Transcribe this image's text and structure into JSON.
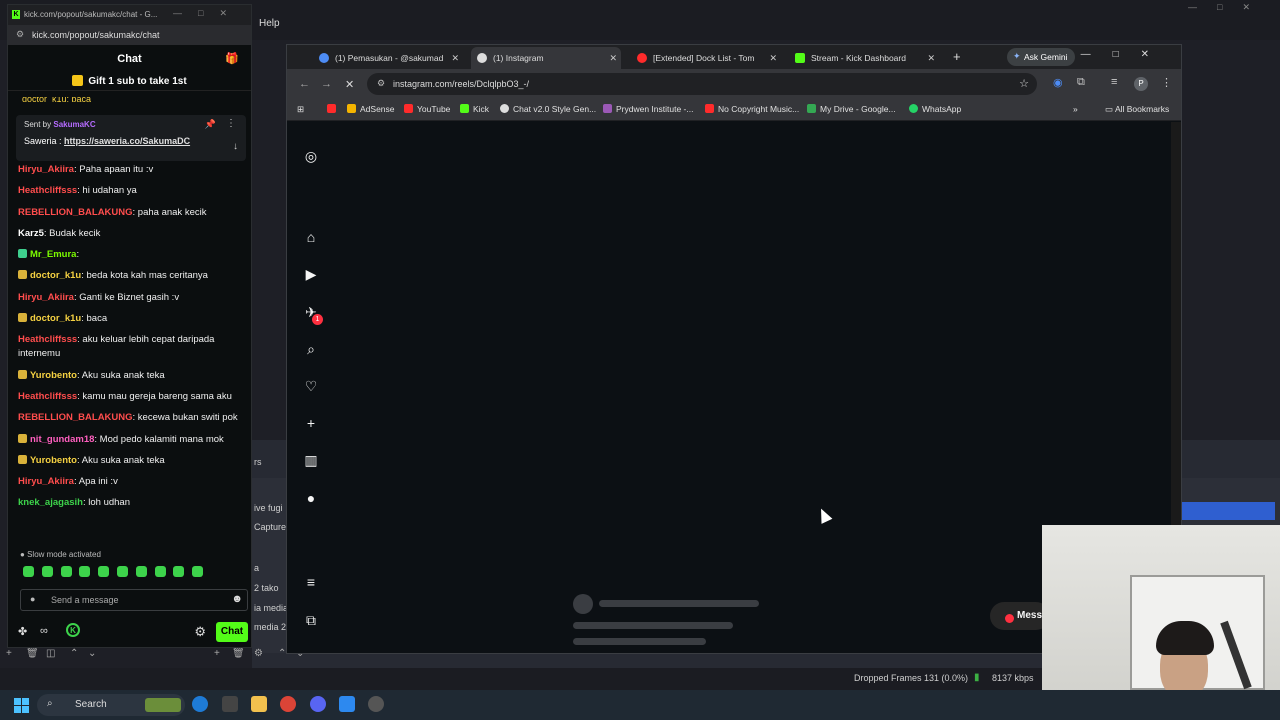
{
  "obs": {
    "menu_help": "Help",
    "dock_items": [
      "rs",
      "ive fugi",
      "Capture",
      "a",
      "2 tako",
      "ia media",
      "media 2"
    ],
    "dropped_frames": "Dropped Frames 131 (0.0%)",
    "bitrate": "8137 kbps",
    "toolbar_icons": [
      "plus-icon",
      "trash-icon",
      "filter-icon",
      "up-icon",
      "down-icon",
      "plus-icon",
      "trash-icon",
      "gear-icon",
      "up-icon",
      "down-icon"
    ]
  },
  "kick": {
    "window_title": "kick.com/popout/sakumakc/chat - G...",
    "url": "kick.com/popout/sakumakc/chat",
    "header": "Chat",
    "gift_text": "Gift 1 sub to take 1st",
    "pinned": {
      "sent_by_label": "Sent by",
      "sender": "SakumaKC",
      "text_prefix": "Saweria : ",
      "link": "https://saweria.co/SakumaDC"
    },
    "partial_top": "doctor_k1u: baca",
    "messages": [
      {
        "user": "Hiryu_Akiira",
        "color": "#ff4d4d",
        "badge": "",
        "text": ": Paha apaan itu :v"
      },
      {
        "user": "Heathcliffsss",
        "color": "#ff4d4d",
        "badge": "",
        "text": ": hi udahan ya"
      },
      {
        "user": "REBELLION_BALAKUNG",
        "color": "#ff4d4d",
        "badge": "",
        "text": ": paha anak kecik"
      },
      {
        "user": "Karz5",
        "color": "#ffffff",
        "badge": "",
        "text": ": Budak kecik"
      },
      {
        "user": "Mr_Emura",
        "color": "#7cfc00",
        "badge": "ic",
        "text": ":"
      },
      {
        "user": "doctor_k1u",
        "color": "#f5d142",
        "badge": "sub",
        "text": ": beda kota kah mas ceritanya"
      },
      {
        "user": "Hiryu_Akiira",
        "color": "#ff4d4d",
        "badge": "",
        "text": ": Ganti ke Biznet gasih :v"
      },
      {
        "user": "doctor_k1u",
        "color": "#f5d142",
        "badge": "sub",
        "text": ": baca"
      },
      {
        "user": "Heathcliffsss",
        "color": "#ff4d4d",
        "badge": "",
        "text": ": aku keluar lebih cepat daripada internemu"
      },
      {
        "user": "Yurobento",
        "color": "#f5d142",
        "badge": "sub",
        "text": ": Aku suka anak teka"
      },
      {
        "user": "Heathcliffsss",
        "color": "#ff4d4d",
        "badge": "",
        "text": ": kamu mau gereja bareng sama aku"
      },
      {
        "user": "REBELLION_BALAKUNG",
        "color": "#ff4d4d",
        "badge": "",
        "text": ": kecewa bukan switi pok"
      },
      {
        "user": "nit_gundam18",
        "color": "#ff5fbf",
        "badge": "sub",
        "text": ": Mod pedo kalamiti mana mok"
      },
      {
        "user": "Yurobento",
        "color": "#f5d142",
        "badge": "sub",
        "text": ": Aku suka anak teka"
      },
      {
        "user": "Hiryu_Akiira",
        "color": "#ff4d4d",
        "badge": "",
        "text": ": Apa ini :v"
      },
      {
        "user": "knek_ajagasih",
        "color": "#3dd34b",
        "badge": "",
        "text": ": loh udhan"
      }
    ],
    "slow_mode": "Slow mode activated",
    "input_placeholder": "Send a message",
    "chat_button": "Chat"
  },
  "chrome": {
    "tabs": [
      {
        "label": "(1) Pemasukan - @sakumad",
        "active": false,
        "icon_color": "#4d8cf5"
      },
      {
        "label": "(1) Instagram",
        "active": true,
        "icon_color": "#dddddd"
      },
      {
        "label": "[Extended] Dock List - Tom",
        "active": false,
        "icon_color": "#ff2b2b"
      },
      {
        "label": "Stream - Kick Dashboard",
        "active": false,
        "icon_color": "#53fc18"
      }
    ],
    "ask_gemini": "Ask Gemini",
    "url": "instagram.com/reels/DclqlpbO3_-/",
    "profile_initial": "P",
    "bookmarks": [
      {
        "label": "",
        "color": "#ff2b2b"
      },
      {
        "label": "AdSense",
        "color": "#f4b400"
      },
      {
        "label": "YouTube",
        "color": "#ff2b2b"
      },
      {
        "label": "Kick",
        "color": "#53fc18"
      },
      {
        "label": "Chat v2.0 Style Gen...",
        "color": "#dddddd"
      },
      {
        "label": "Prydwen Institute -...",
        "color": "#9b59b6"
      },
      {
        "label": "No Copyright Music...",
        "color": "#ff2b2b"
      },
      {
        "label": "My Drive - Google...",
        "color": "#34a853"
      },
      {
        "label": "WhatsApp",
        "color": "#25d366"
      }
    ],
    "all_bookmarks": "All Bookmarks"
  },
  "instagram": {
    "notification_count": "1",
    "messages_label": "Mess"
  },
  "taskbar": {
    "search_label": "Search"
  }
}
